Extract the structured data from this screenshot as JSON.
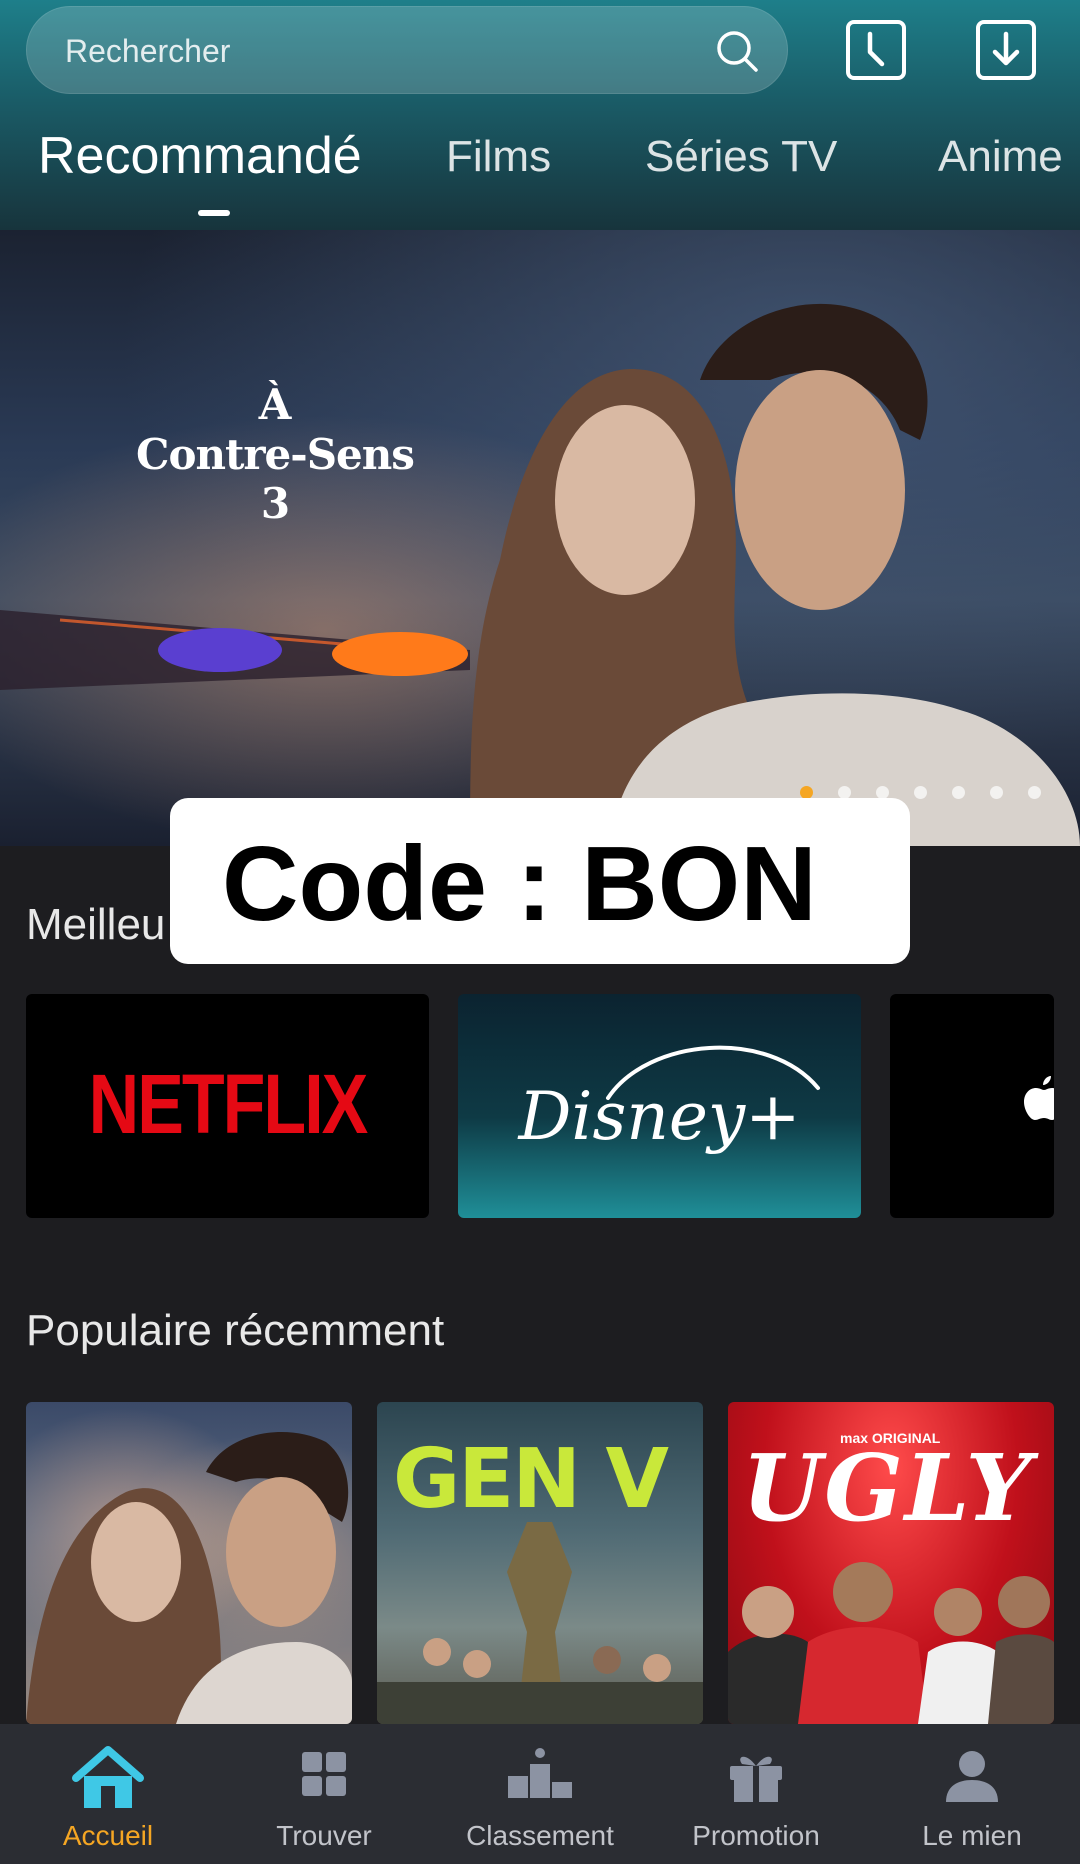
{
  "search": {
    "placeholder": "Rechercher"
  },
  "tabs": [
    "Recommandé",
    "Films",
    "Séries TV",
    "Anime"
  ],
  "hero": {
    "title_line1": "À",
    "title_line2": "Contre-Sens 3",
    "carousel_count": 7,
    "carousel_active": 0
  },
  "overlay": {
    "code_text": "Code : BON"
  },
  "sections": {
    "providers_title": "Meilleu",
    "popular_title": "Populaire récemment"
  },
  "providers": [
    {
      "name": "NETFLIX"
    },
    {
      "name": "Disney+"
    },
    {
      "name": "apple-logo"
    }
  ],
  "popular": [
    {
      "title_art": ""
    },
    {
      "title_art": "GEN V"
    },
    {
      "title_art": "UGLY",
      "tag": "max ORIGINAL"
    }
  ],
  "bottom_nav": [
    {
      "label": "Accueil",
      "icon": "home-icon",
      "active": true
    },
    {
      "label": "Trouver",
      "icon": "grid-icon",
      "active": false
    },
    {
      "label": "Classement",
      "icon": "podium-icon",
      "active": false
    },
    {
      "label": "Promotion",
      "icon": "gift-icon",
      "active": false
    },
    {
      "label": "Le mien",
      "icon": "user-icon",
      "active": false
    }
  ],
  "colors": {
    "accent": "#f5a623",
    "home_icon": "#3fc8e6",
    "netflix_red": "#e50914",
    "header_top": "#1e7f8a",
    "background": "#1d1d20"
  }
}
